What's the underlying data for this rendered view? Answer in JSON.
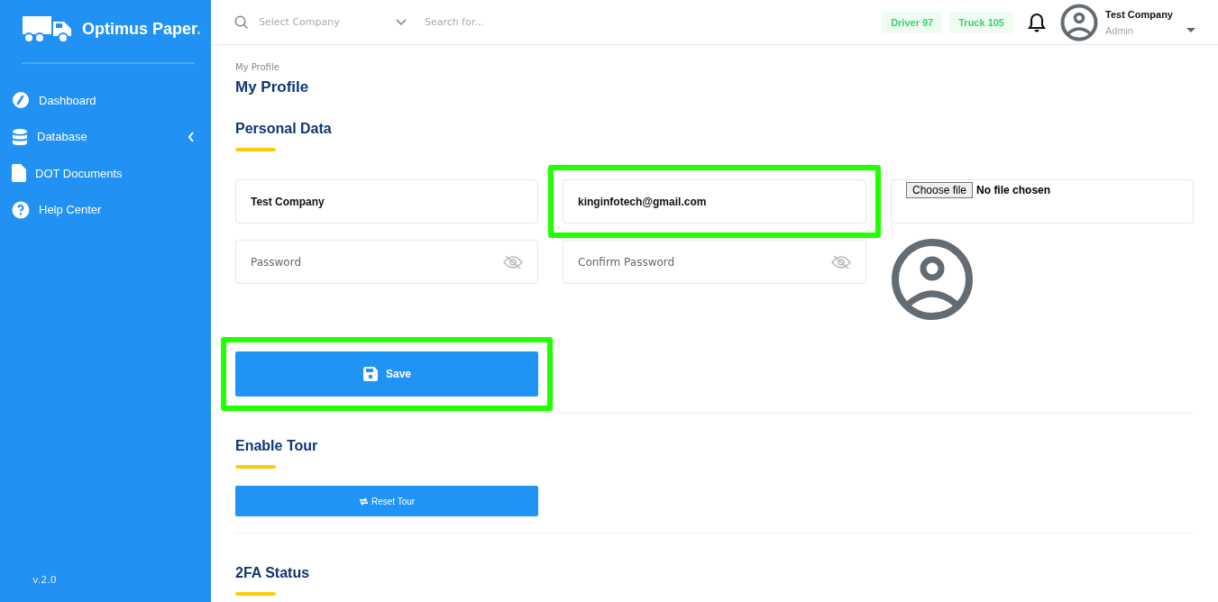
{
  "sidebar": {
    "brand": "Optimus Paper",
    "brand_dot": ".",
    "items": [
      {
        "label": "Dashboard"
      },
      {
        "label": "Database",
        "expanded": false
      },
      {
        "label": "DOT Documents"
      },
      {
        "label": "Help Center"
      }
    ],
    "version": "v.2.0"
  },
  "header": {
    "company_select": {
      "placeholder": "Select Company"
    },
    "search": {
      "placeholder": "Search for..."
    },
    "badges": [
      "Driver 97",
      "Truck 105"
    ],
    "user": {
      "name": "Test Company",
      "role": "Admin"
    }
  },
  "breadcrumb": "My Profile",
  "title": "My Profile",
  "personal_data": {
    "heading": "Personal Data",
    "name": {
      "value": "Test Company",
      "highlighted": false
    },
    "email": {
      "value": "kinginfotech@gmail.com",
      "highlighted": true
    },
    "file": {
      "button": "Choose file",
      "status": "No file chosen"
    },
    "password": {
      "placeholder": "Password"
    },
    "confirm_password": {
      "placeholder": "Confirm Password"
    },
    "save": {
      "label": "Save",
      "highlighted": true
    }
  },
  "tour": {
    "heading": "Enable Tour",
    "button": "Reset Tour"
  },
  "twofa": {
    "heading": "2FA Status"
  }
}
